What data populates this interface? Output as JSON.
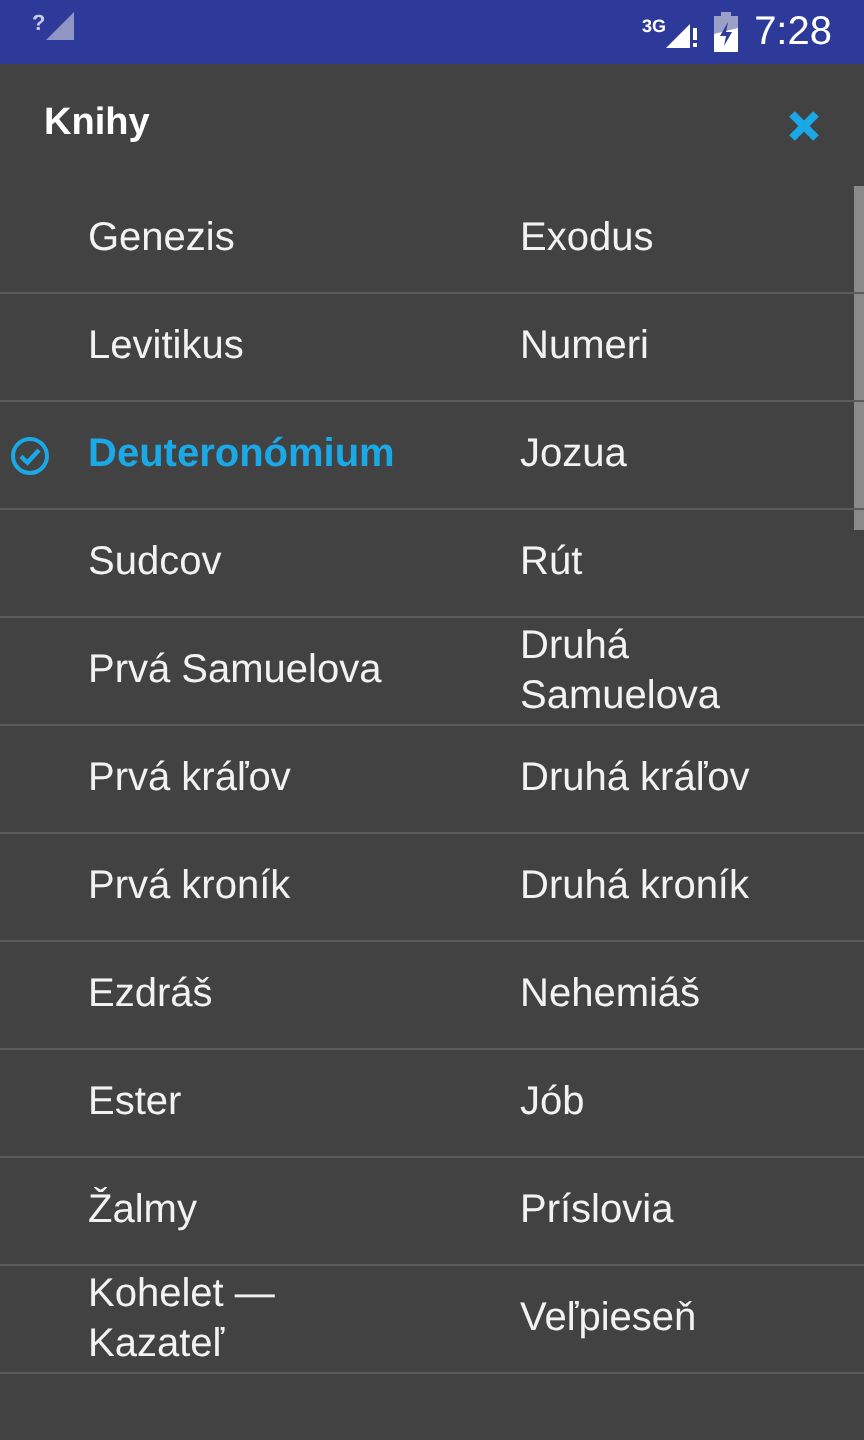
{
  "status_bar": {
    "signal_label": "?",
    "network": "3G",
    "time": "7:28"
  },
  "dialog": {
    "title": "Knihy"
  },
  "books": [
    {
      "name": "Genezis",
      "selected": false
    },
    {
      "name": "Exodus",
      "selected": false
    },
    {
      "name": "Levitikus",
      "selected": false
    },
    {
      "name": "Numeri",
      "selected": false
    },
    {
      "name": "Deuteronómium",
      "selected": true
    },
    {
      "name": "Jozua",
      "selected": false
    },
    {
      "name": "Sudcov",
      "selected": false
    },
    {
      "name": "Rút",
      "selected": false
    },
    {
      "name": "Prvá Samuelova",
      "selected": false
    },
    {
      "name": "Druhá Samuelova",
      "selected": false
    },
    {
      "name": "Prvá kráľov",
      "selected": false
    },
    {
      "name": "Druhá kráľov",
      "selected": false
    },
    {
      "name": "Prvá kroník",
      "selected": false
    },
    {
      "name": "Druhá kroník",
      "selected": false
    },
    {
      "name": "Ezdráš",
      "selected": false
    },
    {
      "name": "Nehemiáš",
      "selected": false
    },
    {
      "name": "Ester",
      "selected": false
    },
    {
      "name": "Jób",
      "selected": false
    },
    {
      "name": "Žalmy",
      "selected": false
    },
    {
      "name": "Príslovia",
      "selected": false
    },
    {
      "name": "Kohelet — Kazateľ",
      "selected": false
    },
    {
      "name": "Veľpieseň",
      "selected": false
    }
  ]
}
